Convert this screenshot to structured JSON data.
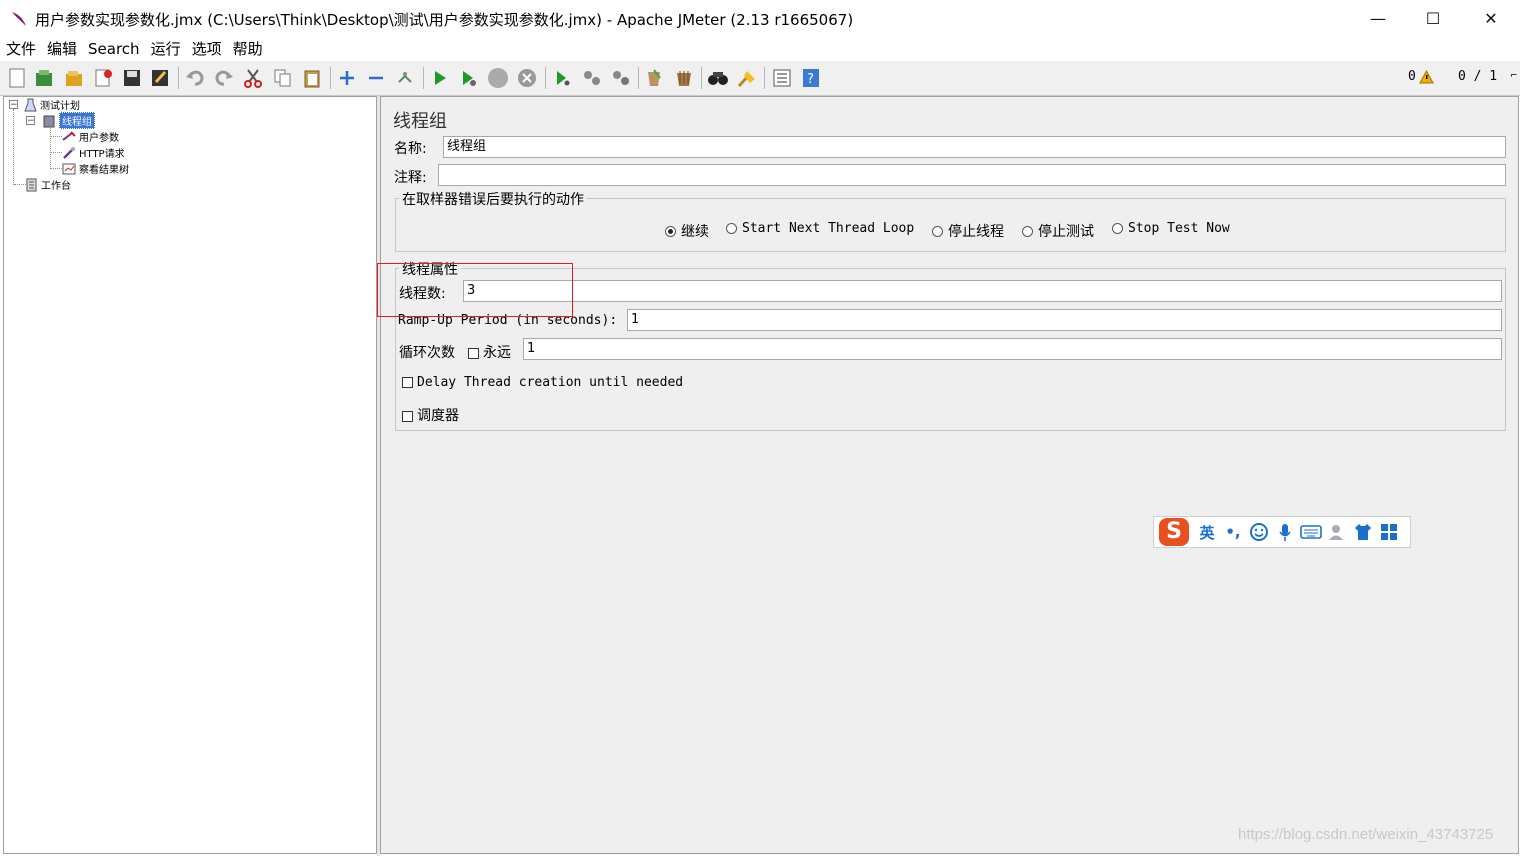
{
  "window": {
    "title": "用户参数实现参数化.jmx (C:\\Users\\Think\\Desktop\\测试\\用户参数实现参数化.jmx) - Apache JMeter (2.13 r1665067)",
    "minimize": "—",
    "maximize": "☐",
    "close": "✕"
  },
  "menu": [
    "文件",
    "编辑",
    "Search",
    "运行",
    "选项",
    "帮助"
  ],
  "toolbar": {
    "icons": [
      "new-icon",
      "templates-icon",
      "open-icon",
      "close-file-icon",
      "save-icon",
      "save-as-icon",
      "undo-icon",
      "redo-icon",
      "cut-icon",
      "copy-icon",
      "paste-icon",
      "expand-icon",
      "collapse-icon",
      "toggle-icon",
      "start-icon",
      "start-no-pause-icon",
      "stop-icon",
      "shutdown-icon",
      "remote-start-icon",
      "remote-stop-icon",
      "remote-shutdown-icon",
      "clear-icon",
      "clear-all-icon",
      "search-icon",
      "reset-search-icon",
      "function-helper-icon",
      "help-icon"
    ],
    "warnings_count": "0",
    "threads_counter": "0 / 1"
  },
  "tree": {
    "test_plan": "测试计划",
    "thread_group": "线程组",
    "user_params": "用户参数",
    "http_request": "HTTP请求",
    "result_tree": "察看结果树",
    "workbench": "工作台"
  },
  "panel": {
    "title": "线程组",
    "name_label": "名称:",
    "name_value": "线程组",
    "comment_label": "注释:",
    "comment_value": "",
    "on_error_legend": "在取样器错误后要执行的动作",
    "on_error_options": [
      "继续",
      "Start Next Thread Loop",
      "停止线程",
      "停止测试",
      "Stop Test Now"
    ],
    "on_error_selected": "继续",
    "thread_props_legend": "线程属性",
    "num_threads_label": "线程数:",
    "num_threads_value": "3",
    "rampup_label": "Ramp-Up Period (in seconds):",
    "rampup_value": "1",
    "loop_label": "循环次数",
    "forever_label": "永远",
    "loop_value": "1",
    "delay_label": "Delay Thread creation until needed",
    "scheduler_label": "调度器"
  },
  "ime": {
    "logo": "S",
    "mode": "英",
    "punct": "•,"
  },
  "watermark": "https://blog.csdn.net/weixin_43743725",
  "colors": {
    "selection": "#3875d7",
    "highlight_box": "#e02020",
    "panel_bg": "#efefef"
  }
}
